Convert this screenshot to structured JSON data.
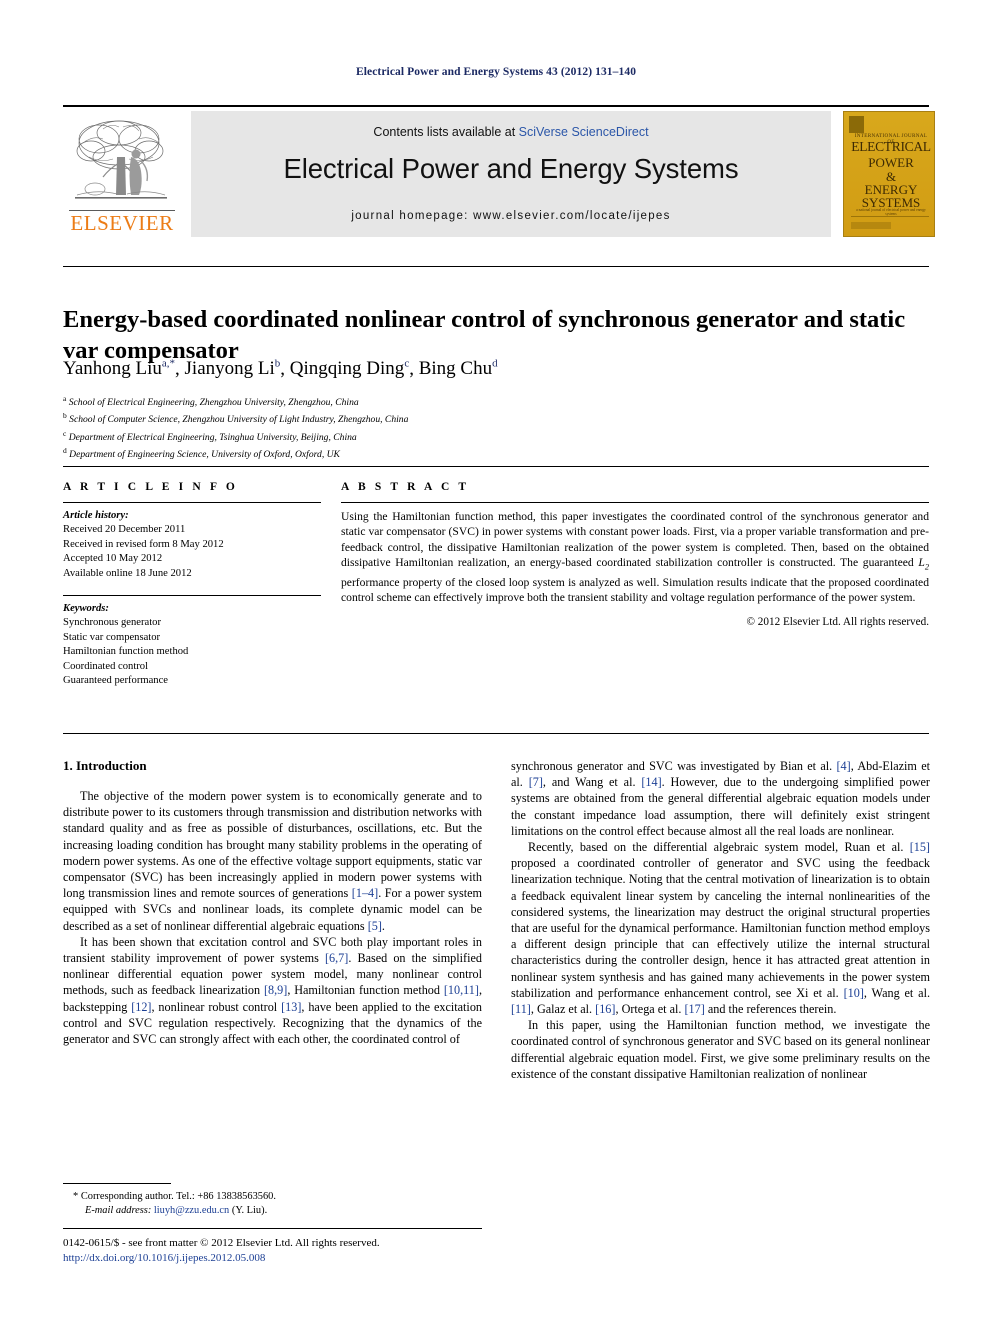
{
  "running_head": "Electrical Power and Energy Systems 43 (2012) 131–140",
  "masthead": {
    "publisher_name": "ELSEVIER",
    "contents_prefix": "Contents lists available at ",
    "contents_link": "SciVerse ScienceDirect",
    "journal_title": "Electrical Power and Energy Systems",
    "homepage": "journal homepage: www.elsevier.com/locate/ijepes",
    "cover": {
      "line_small": "INTERNATIONAL JOURNAL OF",
      "line1": "ELECTRICAL",
      "line2": "POWER",
      "line3": "&",
      "line4": "ENERGY",
      "line5": "SYSTEMS",
      "tagline": "a national journal of electrical power and energy systems",
      "color": "#d4a017"
    }
  },
  "article": {
    "title": "Energy-based coordinated nonlinear control of synchronous generator and static var compensator",
    "authors": [
      {
        "name": "Yanhong Liu",
        "marks": "a,*"
      },
      {
        "name": "Jianyong Li",
        "marks": "b"
      },
      {
        "name": "Qingqing Ding",
        "marks": "c"
      },
      {
        "name": "Bing Chu",
        "marks": "d"
      }
    ],
    "affiliations": [
      {
        "mark": "a",
        "text": "School of Electrical Engineering, Zhengzhou University, Zhengzhou, China"
      },
      {
        "mark": "b",
        "text": "School of Computer Science, Zhengzhou University of Light Industry, Zhengzhou, China"
      },
      {
        "mark": "c",
        "text": "Department of Electrical Engineering, Tsinghua University, Beijing, China"
      },
      {
        "mark": "d",
        "text": "Department of Engineering Science, University of Oxford, Oxford, UK"
      }
    ]
  },
  "info": {
    "heading": "A R T I C L E    I N F O",
    "history_label": "Article history:",
    "history": [
      "Received 20 December 2011",
      "Received in revised form 8 May 2012",
      "Accepted 10 May 2012",
      "Available online 18 June 2012"
    ],
    "keywords_label": "Keywords:",
    "keywords": [
      "Synchronous generator",
      "Static var compensator",
      "Hamiltonian function method",
      "Coordinated control",
      "Guaranteed performance"
    ]
  },
  "abstract": {
    "heading": "A B S T R A C T",
    "part1": "Using the Hamiltonian function method, this paper investigates the coordinated control of the synchronous generator and static var compensator (SVC) in power systems with constant power loads. First, via a proper variable transformation and pre-feedback control, the dissipative Hamiltonian realization of the power system is completed. Then, based on the obtained dissipative Hamiltonian realization, an energy-based coordinated stabilization controller is constructed. The guaranteed ",
    "l_symbol": "L",
    "l_sub": "2",
    "part2": " performance property of the closed loop system is analyzed as well. Simulation results indicate that the proposed coordinated control scheme can effectively improve both the transient stability and voltage regulation performance of the power system.",
    "copyright": "© 2012 Elsevier Ltd. All rights reserved."
  },
  "body": {
    "section_heading": "1. Introduction",
    "left_paragraphs": [
      "The objective of the modern power system is to economically generate and to distribute power to its customers through transmission and distribution networks with standard quality and as free as possible of disturbances, oscillations, etc. But the increasing loading condition has brought many stability problems in the operating of modern power systems. As one of the effective voltage support equipments, static var compensator (SVC) has been increasingly applied in modern power systems with long transmission lines and remote sources of generations [1–4]. For a power system equipped with SVCs and nonlinear loads, its complete dynamic model can be described as a set of nonlinear differential algebraic equations [5].",
      "It has been shown that excitation control and SVC both play important roles in transient stability improvement of power systems [6,7]. Based on the simplified nonlinear differential equation power system model, many nonlinear control methods, such as feedback linearization [8,9], Hamiltonian function method [10,11], backstepping [12], nonlinear robust control [13], have been applied to the excitation control and SVC regulation respectively. Recognizing that the dynamics of the generator and SVC can strongly affect with each other, the coordinated control of"
    ],
    "right_paragraphs": [
      "synchronous generator and SVC was investigated by Bian et al. [4], Abd-Elazim et al. [7], and Wang et al. [14]. However, due to the undergoing simplified power systems are obtained from the general differential algebraic equation models under the constant impedance load assumption, there will definitely exist stringent limitations on the control effect because almost all the real loads are nonlinear.",
      "Recently, based on the differential algebraic system model, Ruan et al. [15] proposed a coordinated controller of generator and SVC using the feedback linearization technique. Noting that the central motivation of linearization is to obtain a feedback equivalent linear system by canceling the internal nonlinearities of the considered systems, the linearization may destruct the original structural properties that are useful for the dynamical performance. Hamiltonian function method employs a different design principle that can effectively utilize the internal structural characteristics during the controller design, hence it has attracted great attention in nonlinear system synthesis and has gained many achievements in the power system stabilization and performance enhancement control, see Xi et al. [10], Wang et al. [11], Galaz et al. [16], Ortega et al. [17] and the references therein.",
      "In this paper, using the Hamiltonian function method, we investigate the coordinated control of synchronous generator and SVC based on its general nonlinear differential algebraic equation model. First, we give some preliminary results on the existence of the constant dissipative Hamiltonian realization of nonlinear"
    ]
  },
  "footnote": {
    "marker": "*",
    "corresponding": "Corresponding author. Tel.: +86 13838563560.",
    "email_label": "E-mail address:",
    "email": "liuyh@zzu.edu.cn",
    "email_suffix": "(Y. Liu)."
  },
  "footer": {
    "issn_line": "0142-0615/$ - see front matter © 2012 Elsevier Ltd. All rights reserved.",
    "doi": "http://dx.doi.org/10.1016/j.ijepes.2012.05.008"
  }
}
